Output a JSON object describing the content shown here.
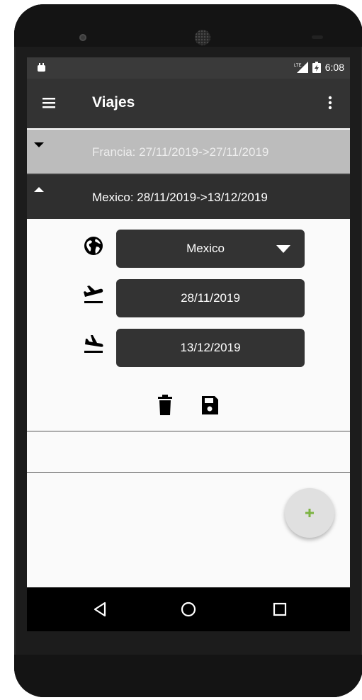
{
  "status_bar": {
    "network": "LTE",
    "time": "6:08"
  },
  "app_bar": {
    "title": "Viajes",
    "menu_icon": "hamburger-menu-icon",
    "more_icon": "more-vert-icon"
  },
  "trips": [
    {
      "label": "Francia: 27/11/2019->27/11/2019",
      "expanded": false
    },
    {
      "label": "Mexico: 28/11/2019->13/12/2019",
      "expanded": true
    }
  ],
  "detail": {
    "country": "Mexico",
    "departure_date": "28/11/2019",
    "return_date": "13/12/2019"
  },
  "fab": {
    "icon": "plus-icon",
    "color": "#7cb342"
  },
  "colors": {
    "app_bar": "#333333",
    "collapsed_header": "#bcbcbc",
    "expanded_header": "#2f2f2f",
    "field": "#333333",
    "accent": "#7cb342"
  }
}
